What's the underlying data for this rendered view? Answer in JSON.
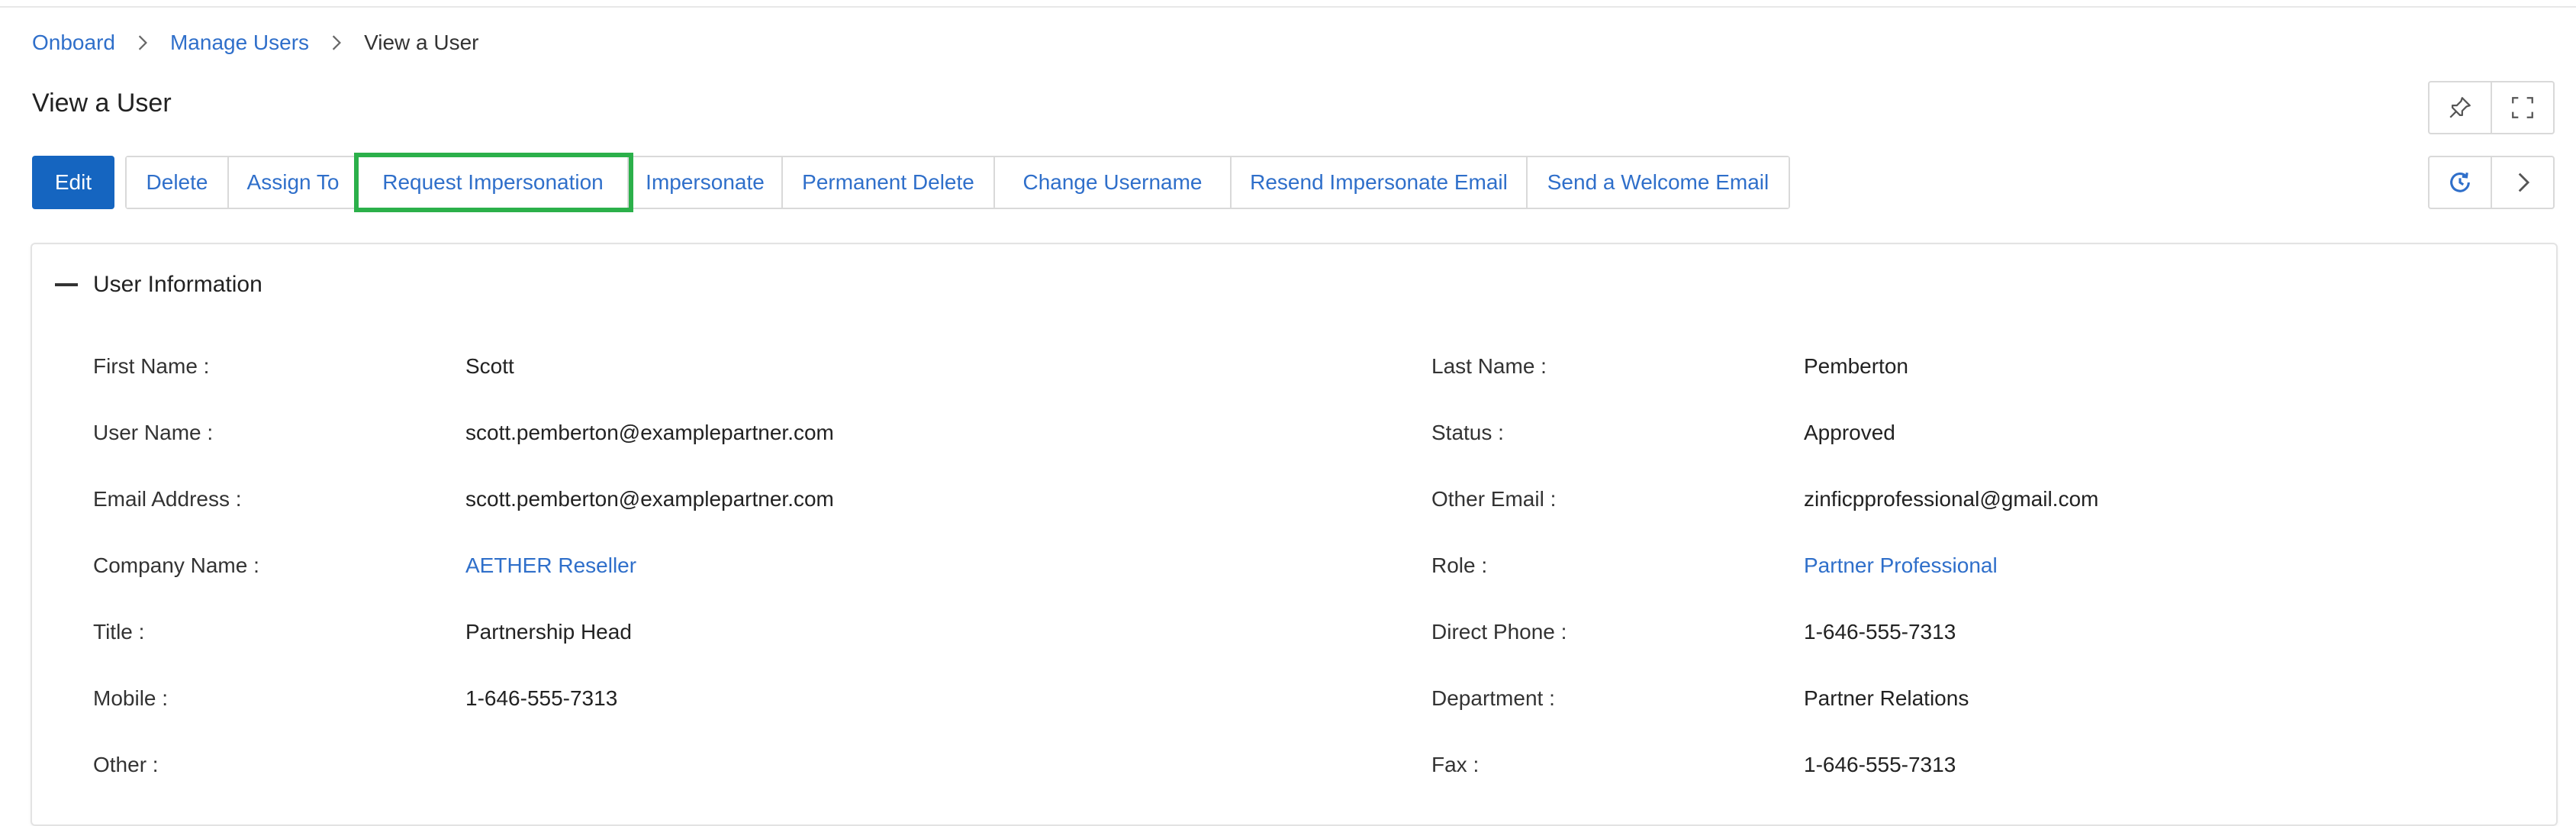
{
  "breadcrumb": {
    "items": [
      {
        "label": "Onboard"
      },
      {
        "label": "Manage Users"
      },
      {
        "label": "View a User"
      }
    ]
  },
  "page": {
    "title": "View a User"
  },
  "toolbar": {
    "edit": "Edit",
    "actions": [
      {
        "label": "Delete"
      },
      {
        "label": "Assign To"
      },
      {
        "label": "Request Impersonation"
      },
      {
        "label": "Impersonate"
      },
      {
        "label": "Permanent Delete"
      },
      {
        "label": "Change Username"
      },
      {
        "label": "Resend Impersonate Email"
      },
      {
        "label": "Send a Welcome Email"
      }
    ],
    "highlight_color": "#2bb04a",
    "primary_color": "#1565c0"
  },
  "icons": {
    "top_right": [
      "pin-icon",
      "expand-icon"
    ],
    "nav": [
      "history-icon",
      "chevron-right-icon"
    ]
  },
  "section": {
    "title": "User Information",
    "left": [
      {
        "label": "First Name :",
        "value": "Scott"
      },
      {
        "label": "User Name :",
        "value": "scott.pemberton@examplepartner.com"
      },
      {
        "label": "Email Address :",
        "value": "scott.pemberton@examplepartner.com"
      },
      {
        "label": "Company Name :",
        "value": "AETHER Reseller"
      },
      {
        "label": "Title :",
        "value": "Partnership Head"
      },
      {
        "label": "Mobile :",
        "value": "1-646-555-7313"
      },
      {
        "label": "Other :",
        "value": ""
      }
    ],
    "right": [
      {
        "label": "Last Name :",
        "value": "Pemberton"
      },
      {
        "label": "Status :",
        "value": "Approved"
      },
      {
        "label": "Other Email :",
        "value": "zinficpprofessional@gmail.com"
      },
      {
        "label": "Role :",
        "value": "Partner Professional"
      },
      {
        "label": "Direct Phone :",
        "value": "1-646-555-7313"
      },
      {
        "label": "Department :",
        "value": "Partner Relations"
      },
      {
        "label": "Fax :",
        "value": "1-646-555-7313"
      }
    ]
  }
}
